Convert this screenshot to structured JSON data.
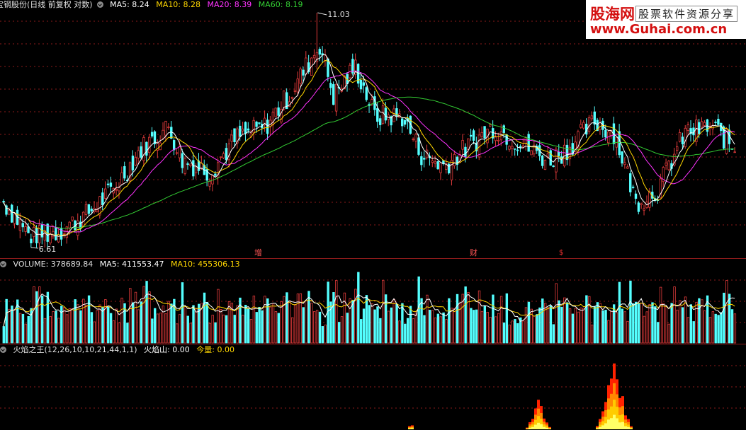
{
  "price_panel": {
    "title": "宝钢股份(日线 前复权 对数)",
    "indicators": [
      {
        "label": "MA5: 8.24",
        "color": "#ffffff"
      },
      {
        "label": "MA10: 8.28",
        "color": "#ffd700"
      },
      {
        "label": "MA20: 8.39",
        "color": "#ff33ff"
      },
      {
        "label": "MA60: 8.19",
        "color": "#33cc33"
      }
    ],
    "high_label": "11.03",
    "low_label": "6.61",
    "markers": [
      {
        "text": "增",
        "color": "#ff5555"
      },
      {
        "text": "财",
        "color": "#ff5555"
      },
      {
        "text": "$",
        "color": "#ff3333"
      }
    ]
  },
  "volume_panel": {
    "title": "VOLUME: 378689.84",
    "indicators": [
      {
        "label": "MA5: 411553.47",
        "color": "#ffffff"
      },
      {
        "label": "MA10: 455306.13",
        "color": "#ffd700"
      }
    ]
  },
  "flame_panel": {
    "title": "火焰之王(12,26,10,10,21,44,1,1)",
    "indicators": [
      {
        "label": "火焰山: 0.00",
        "color": "#ffffff"
      },
      {
        "label": "今量: 0.00",
        "color": "#ffd700"
      }
    ]
  },
  "watermark": {
    "name": "股海网",
    "slogan": "股票软件资源分享",
    "url": "www.Guhai.com.cn"
  },
  "colors": {
    "up": "#e23b3b",
    "down": "#54ffff",
    "grid": "#8b1a1a"
  },
  "chart_data": {
    "type": "candlestick",
    "scale": "log",
    "ylim": [
      6.61,
      11.03
    ],
    "high": 11.03,
    "low": 6.61,
    "close_trend_anchors": [
      [
        0,
        7.3
      ],
      [
        10,
        6.75
      ],
      [
        20,
        6.85
      ],
      [
        30,
        7.1
      ],
      [
        40,
        7.5
      ],
      [
        50,
        8.2
      ],
      [
        60,
        8.6
      ],
      [
        65,
        8.0
      ],
      [
        75,
        7.8
      ],
      [
        85,
        8.4
      ],
      [
        95,
        8.6
      ],
      [
        105,
        9.3
      ],
      [
        115,
        10.3
      ],
      [
        120,
        9.2
      ],
      [
        128,
        9.8
      ],
      [
        135,
        8.8
      ],
      [
        145,
        8.8
      ],
      [
        152,
        8.1
      ],
      [
        160,
        7.9
      ],
      [
        168,
        8.2
      ],
      [
        178,
        8.6
      ],
      [
        188,
        8.3
      ],
      [
        198,
        8.0
      ],
      [
        205,
        8.2
      ],
      [
        215,
        8.7
      ],
      [
        222,
        8.5
      ],
      [
        230,
        7.3
      ],
      [
        238,
        7.5
      ],
      [
        248,
        8.5
      ],
      [
        258,
        8.6
      ],
      [
        266,
        8.2
      ]
    ],
    "ma_values": {
      "MA5": 8.24,
      "MA10": 8.28,
      "MA20": 8.39,
      "MA60": 8.19
    },
    "volume_values": {
      "VOLUME": 378689.84,
      "MA5": 411553.47,
      "MA10": 455306.13
    },
    "flame_values": {
      "火焰山": 0.0,
      "今量": 0.0
    }
  }
}
